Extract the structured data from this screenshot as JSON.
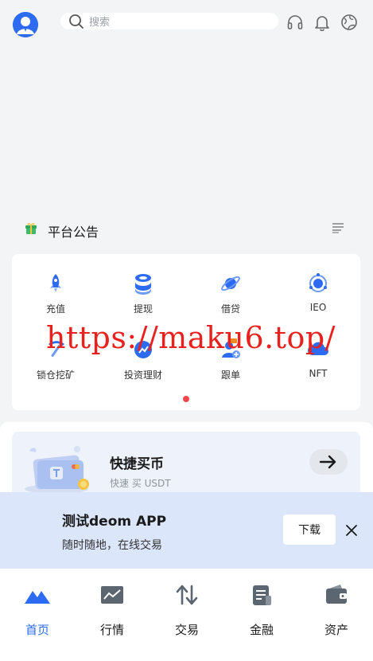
{
  "header": {
    "search_placeholder": "搜索",
    "icons": [
      "avatar",
      "search-icon",
      "headset-icon",
      "bell-icon",
      "globe-icon"
    ]
  },
  "notice": {
    "title": "平台公告"
  },
  "grid": {
    "items": [
      {
        "label": "充值",
        "icon": "rocket-icon"
      },
      {
        "label": "提现",
        "icon": "coins-icon"
      },
      {
        "label": "借贷",
        "icon": "planet-icon"
      },
      {
        "label": "IEO",
        "icon": "target-icon"
      },
      {
        "label": "锁仓挖矿",
        "icon": "pickaxe-icon"
      },
      {
        "label": "投资理财",
        "icon": "invest-icon"
      },
      {
        "label": "跟单",
        "icon": "follow-icon"
      },
      {
        "label": "NFT",
        "icon": "cloud-icon"
      }
    ],
    "page_indicator": {
      "pages": 1,
      "active": 1
    }
  },
  "watermark": "https://maku6.top/",
  "quick_buy": {
    "title": "快捷买币",
    "subtitle": "快速 买 USDT"
  },
  "app_banner": {
    "title": "测试deom APP",
    "subtitle": "随时随地，在线交易",
    "download_label": "下载"
  },
  "tabs": [
    {
      "label": "首页",
      "active": true
    },
    {
      "label": "行情",
      "active": false
    },
    {
      "label": "交易",
      "active": false
    },
    {
      "label": "金融",
      "active": false
    },
    {
      "label": "资产",
      "active": false
    }
  ],
  "colors": {
    "accent": "#2d6cf2",
    "watermark": "#e8201e",
    "app_banner_bg": "#dbe6fb",
    "indicator": "#f0484a"
  }
}
